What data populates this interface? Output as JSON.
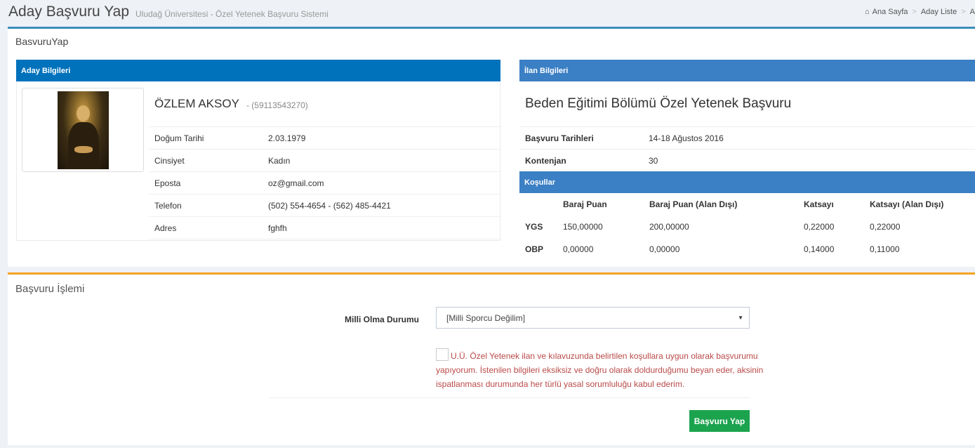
{
  "header": {
    "title": "Aday Başvuru Yap",
    "subtitle": "Uludağ Üniversitesi - Özel Yetenek Başvuru Sistemi"
  },
  "breadcrumb": {
    "home_icon": "home-icon",
    "items": [
      "Ana Sayfa",
      "Aday Liste",
      "A"
    ]
  },
  "portlet_top": {
    "title": "BasvuruYap"
  },
  "aday": {
    "header": "Aday Bilgileri",
    "name": "ÖZLEM AKSOY",
    "tc": "- (59113543270)",
    "rows": [
      {
        "label": "Doğum Tarihi",
        "value": "2.03.1979"
      },
      {
        "label": "Cinsiyet",
        "value": "Kadın"
      },
      {
        "label": "Eposta",
        "value": "oz@gmail.com"
      },
      {
        "label": "Telefon",
        "value": "(502) 554-4654 - (562) 485-4421"
      },
      {
        "label": "Adres",
        "value": "fghfh"
      }
    ]
  },
  "ilan": {
    "header": "İlan Bilgileri",
    "title": "Beden Eğitimi Bölümü Özel Yetenek Başvuru",
    "rows": [
      {
        "label": "Başvuru Tarihleri",
        "value": "14-18 Ağustos 2016"
      },
      {
        "label": "Kontenjan",
        "value": "30"
      }
    ]
  },
  "kosullar": {
    "header": "Koşullar",
    "columns": [
      "",
      "Baraj Puan",
      "Baraj Puan (Alan Dışı)",
      "Katsayı",
      "Katsayı (Alan Dışı)"
    ],
    "rows": [
      [
        "YGS",
        "150,00000",
        "200,00000",
        "0,22000",
        "0,22000"
      ],
      [
        "OBP",
        "0,00000",
        "0,00000",
        "0,14000",
        "0,11000"
      ]
    ]
  },
  "basvuru": {
    "title": "Başvuru İşlemi",
    "milli_label": "Milli Olma Durumu",
    "milli_selected": "[Milli Sporcu Değilim]",
    "consent_text": "U.Ü. Özel Yetenek ilan ve kılavuzunda belirtilen koşullara uygun olarak başvurumu yapıyorum. İstenilen bilgileri eksiksiz ve doğru olarak doldurduğumu beyan eder, aksinin ispatlanması durumunda her türlü yasal sorumluluğu kabul ederim.",
    "submit_label": "Başvuru Yap"
  }
}
